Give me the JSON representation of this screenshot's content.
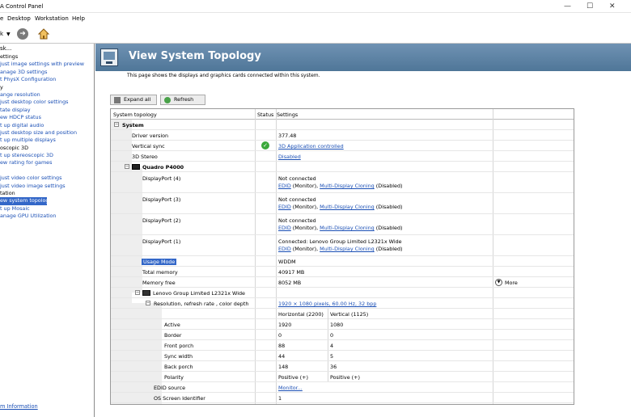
{
  "window": {
    "title": "A Control Panel",
    "controls": {
      "min": "—",
      "max": "☐",
      "close": "✕"
    }
  },
  "menu": {
    "file": "e",
    "desktop": "Desktop",
    "workstation": "Workstation",
    "help": "Help"
  },
  "toolbar": {
    "back_label": "k"
  },
  "sidebar": {
    "task_label": "sk...",
    "items": [
      {
        "label": "ettings",
        "kind": "cat"
      },
      {
        "label": "just image settings with preview",
        "kind": "link"
      },
      {
        "label": "anage 3D settings",
        "kind": "link"
      },
      {
        "label": "t PhysX Configuration",
        "kind": "link"
      },
      {
        "label": "y",
        "kind": "cat"
      },
      {
        "label": "ange resolution",
        "kind": "link"
      },
      {
        "label": "just desktop color settings",
        "kind": "link"
      },
      {
        "label": "tate display",
        "kind": "link"
      },
      {
        "label": "ew HDCP status",
        "kind": "link"
      },
      {
        "label": "t up digital audio",
        "kind": "link"
      },
      {
        "label": "just desktop size and position",
        "kind": "link"
      },
      {
        "label": "t up multiple displays",
        "kind": "link"
      },
      {
        "label": "oscopic 3D",
        "kind": "cat"
      },
      {
        "label": "t up stereoscopic 3D",
        "kind": "link"
      },
      {
        "label": "ew rating for games",
        "kind": "link"
      },
      {
        "label": "",
        "kind": "cat"
      },
      {
        "label": "just video color settings",
        "kind": "link"
      },
      {
        "label": "just video image settings",
        "kind": "link"
      },
      {
        "label": "tation",
        "kind": "cat"
      },
      {
        "label": "ew system topology",
        "kind": "sel"
      },
      {
        "label": "t up Mosaic",
        "kind": "link"
      },
      {
        "label": "anage GPU Utilization",
        "kind": "link"
      }
    ],
    "system_info": "m Information"
  },
  "page": {
    "title": "View System Topology",
    "description": "This page shows the displays and graphics cards connected within this system.",
    "expand_all": "Expand all",
    "refresh": "Refresh"
  },
  "grid": {
    "headers": {
      "topology": "System topology",
      "status": "Status",
      "settings": "Settings"
    },
    "system": "System",
    "driver_version_label": "Driver version",
    "driver_version": "377.48",
    "vsync_label": "Vertical sync",
    "vsync_value": "3D Application controlled",
    "stereo_label": "3D Stereo",
    "stereo_value": "Disabled",
    "gpu": "Quadro P4000",
    "ports": [
      {
        "name": "DisplayPort (4)",
        "line1": "Not connected",
        "edid": "EDID",
        "monitor": " (Monitor), ",
        "clone": "Multi-Display Cloning",
        "dis": " (Disabled)"
      },
      {
        "name": "DisplayPort (3)",
        "line1": "Not connected",
        "edid": "EDID",
        "monitor": " (Monitor), ",
        "clone": "Multi-Display Cloning",
        "dis": " (Disabled)"
      },
      {
        "name": "DisplayPort (2)",
        "line1": "Not connected",
        "edid": "EDID",
        "monitor": " (Monitor), ",
        "clone": "Multi-Display Cloning",
        "dis": " (Disabled)"
      },
      {
        "name": "DisplayPort (1)",
        "line1": "Connected: Lenovo Group Limited L2321x Wide",
        "edid": "EDID",
        "monitor": " (Monitor), ",
        "clone": "Multi-Display Cloning",
        "dis": " (Disabled)"
      }
    ],
    "usage_mode_label": "Usage Mode",
    "usage_mode": "WDDM",
    "total_memory_label": "Total memory",
    "total_memory": "40917 MB",
    "memory_free_label": "Memory free",
    "memory_free": "8052 MB",
    "more": "More",
    "monitor": "Lenovo Group Limited L2321x Wide",
    "resolution_label": "Resolution, refresh rate , color depth",
    "resolution_value": "1920 × 1080 pixels, 60.00 Hz, 32 bpp",
    "horizontal_header": "Horizontal (2200)",
    "vertical_header": "Vertical (1125)",
    "timing": [
      {
        "label": "Active",
        "h": "1920",
        "v": "1080"
      },
      {
        "label": "Border",
        "h": "0",
        "v": "0"
      },
      {
        "label": "Front porch",
        "h": "88",
        "v": "4"
      },
      {
        "label": "Sync width",
        "h": "44",
        "v": "5"
      },
      {
        "label": "Back porch",
        "h": "148",
        "v": "36"
      },
      {
        "label": "Polarity",
        "h": "Positive (+)",
        "v": "Positive (+)"
      }
    ],
    "edid_source_label": "EDID source",
    "edid_source": "Monitor...",
    "os_id_label": "OS Screen Identifier",
    "os_id": "1"
  }
}
